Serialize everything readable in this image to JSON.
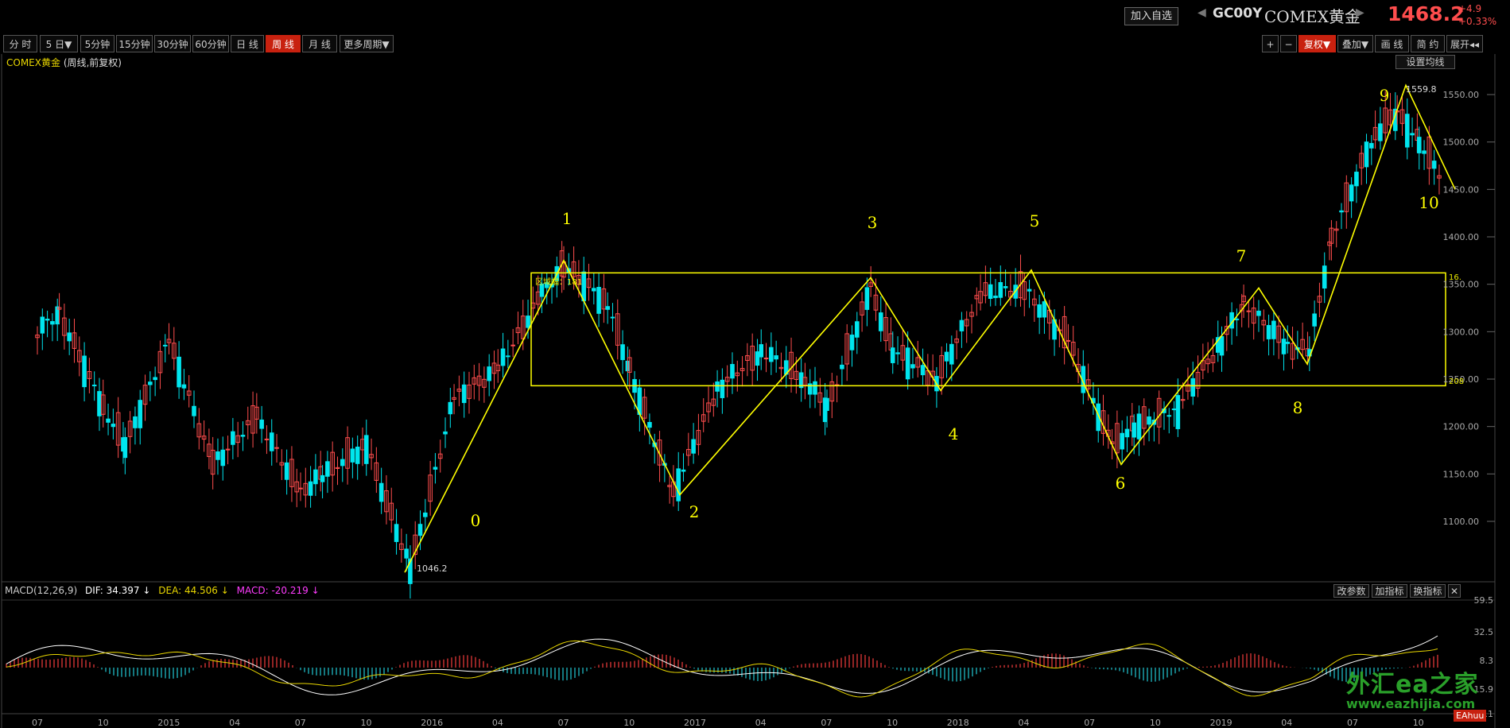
{
  "header": {
    "add_watchlist": "加入自选",
    "symbol_code": "GC00Y",
    "symbol_name": "COMEX黄金",
    "last_price": "1468.2",
    "change": "+4.9",
    "change_pct": "+0.33%"
  },
  "toolbar": {
    "periods": [
      "分 时",
      "5 日▼",
      "5分钟",
      "15分钟",
      "30分钟",
      "60分钟",
      "日 线",
      "周 线",
      "月 线",
      "更多周期▼"
    ],
    "active_period": "周 线",
    "right_buttons": [
      "+",
      "−",
      "复权▼",
      "叠加▼",
      "画 线",
      "简 约",
      "展开◂◂"
    ]
  },
  "chart_title": {
    "name": "COMEX黄金",
    "mode": "(周线,前复权)",
    "set_ma": "设置均线"
  },
  "price_axis": {
    "labels": [
      "1550.00",
      "1500.00",
      "1450.00",
      "1400.00",
      "1350.00",
      "1300.00",
      "1250.00",
      "1200.00",
      "1150.00",
      "1100.00"
    ],
    "min_label": "1046.2",
    "max_label": "1559.8"
  },
  "time_axis": {
    "labels": [
      "07",
      "10",
      "2015",
      "04",
      "07",
      "10",
      "2016",
      "04",
      "07",
      "10",
      "2017",
      "04",
      "07",
      "10",
      "2018",
      "04",
      "07",
      "10",
      "2019",
      "04",
      "07",
      "10"
    ]
  },
  "waves": {
    "labels": [
      "0",
      "1",
      "2",
      "3",
      "4",
      "5",
      "6",
      "7",
      "8",
      "9",
      "10"
    ]
  },
  "box": {
    "left_label": "区域幅：181",
    "right_top": "16.",
    "right_bottom": "208"
  },
  "macd": {
    "name": "MACD(12,26,9)",
    "dif_label": "DIF: 34.397 ↓",
    "dea_label": "DEA: 44.506 ↓",
    "macd_label": "MACD: -20.219 ↓",
    "buttons": [
      "改参数",
      "加指标",
      "换指标",
      "✕"
    ],
    "axis_labels": [
      "59.5",
      "32.5",
      "8.3",
      "-15.9",
      "-40.1"
    ]
  },
  "watermark": {
    "cn": "外汇ea之家",
    "en": "www.eazhijia.com",
    "logo": "EAhuu"
  },
  "colors": {
    "up": "#ff4d4d",
    "down": "#00e5ee",
    "wave": "#ffff00",
    "ma": "#e8d600"
  },
  "chart_data": {
    "type": "candlestick",
    "title": "COMEX黄金 (周线,前复权)",
    "ylim": [
      1040,
      1570
    ],
    "wave_points": [
      {
        "label": "0",
        "x": "2015-12",
        "y": 1046.2
      },
      {
        "label": "1",
        "x": "2016-07",
        "y": 1375
      },
      {
        "label": "2",
        "x": "2016-12",
        "y": 1128
      },
      {
        "label": "3",
        "x": "2017-09",
        "y": 1357
      },
      {
        "label": "4",
        "x": "2017-12",
        "y": 1238
      },
      {
        "label": "5",
        "x": "2018-04",
        "y": 1365
      },
      {
        "label": "6",
        "x": "2018-08",
        "y": 1160
      },
      {
        "label": "7",
        "x": "2019-02",
        "y": 1346
      },
      {
        "label": "8",
        "x": "2019-05",
        "y": 1266
      },
      {
        "label": "9",
        "x": "2019-09",
        "y": 1559.8
      },
      {
        "label": "10",
        "x": "2019-11",
        "y": 1450
      }
    ],
    "range_box": {
      "top": 1362,
      "bottom": 1243
    }
  }
}
